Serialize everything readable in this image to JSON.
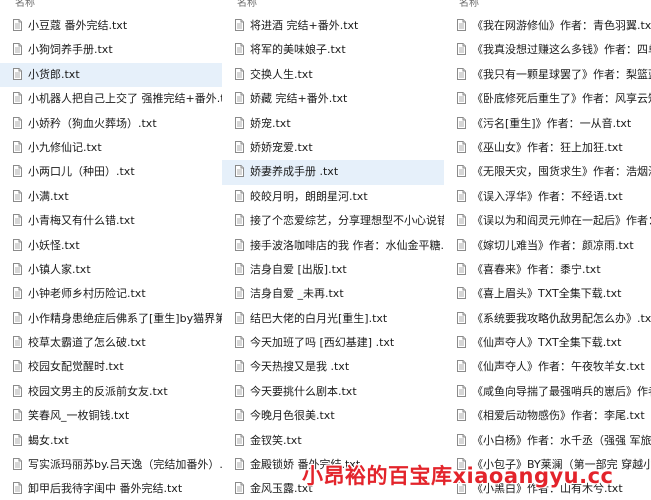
{
  "columns": [
    {
      "header": "名称",
      "files": [
        {
          "name": "小豆蔻 番外完结.txt"
        },
        {
          "name": "小狗饲养手册.txt"
        },
        {
          "name": "小货郎.txt",
          "selected": true
        },
        {
          "name": "小机器人把自己上交了 强推完结+番外.txt"
        },
        {
          "name": "小娇矜（狗血火葬场）.txt"
        },
        {
          "name": "小九修仙记.txt"
        },
        {
          "name": "小两口儿（种田）.txt"
        },
        {
          "name": "小满.txt"
        },
        {
          "name": "小青梅又有什么错.txt"
        },
        {
          "name": "小妖怪.txt"
        },
        {
          "name": "小镇人家.txt"
        },
        {
          "name": "小钟老师乡村历险记.txt"
        },
        {
          "name": "小作精身患绝症后佛系了[重生]by猫界第..."
        },
        {
          "name": "校草太霸道了怎么破.txt"
        },
        {
          "name": "校园女配觉醒时.txt"
        },
        {
          "name": "校园文男主的反派前女友.txt"
        },
        {
          "name": "笑春风_一枚铜钱.txt"
        },
        {
          "name": "蝎女.txt"
        },
        {
          "name": "写实派玛丽苏by.吕天逸（完结加番外）..."
        },
        {
          "name": "卸甲后我待字闺中 番外完结.txt"
        }
      ]
    },
    {
      "header": "名称",
      "files": [
        {
          "name": "将进酒 完结+番外.txt"
        },
        {
          "name": "将军的美味娘子.txt"
        },
        {
          "name": "交换人生.txt"
        },
        {
          "name": "娇藏 完结+番外.txt"
        },
        {
          "name": "娇宠.txt"
        },
        {
          "name": "娇娇宠爱.txt"
        },
        {
          "name": "娇妻养成手册 .txt",
          "selected": true
        },
        {
          "name": "皎皎月明，朗朗星河.txt"
        },
        {
          "name": "接了个恋爱综艺，分享理想型不小心说错..."
        },
        {
          "name": "接手波洛咖啡店的我 作者：水仙金平糖.t..."
        },
        {
          "name": "洁身自爱 [出版].txt"
        },
        {
          "name": "洁身自爱 _未再.txt"
        },
        {
          "name": "结巴大佬的白月光[重生].txt"
        },
        {
          "name": "今天加班了吗 [西幻基建] .txt"
        },
        {
          "name": "今天热搜又是我 .txt"
        },
        {
          "name": "今天要挑什么剧本.txt"
        },
        {
          "name": "今晚月色很美.txt"
        },
        {
          "name": "金钗笑.txt"
        },
        {
          "name": "金殿锁娇 番外完结.txt"
        },
        {
          "name": "金风玉露.txt"
        }
      ]
    },
    {
      "header": "名称",
      "files": [
        {
          "name": "《我在网游修仙》作者：青色羽翼.txt"
        },
        {
          "name": "《我真没想过赚这么多钱》作者：四单猪..."
        },
        {
          "name": "《我只有一颗星球罢了》作者：梨篮蓝.txt"
        },
        {
          "name": "《卧底修死后重生了》作者：风享云知道..."
        },
        {
          "name": "《污名[重生]》作者：一从音.txt"
        },
        {
          "name": "《巫山女》作者：狂上加狂.txt"
        },
        {
          "name": "《无限天灾，囤货求生》作者：浩烟海.txt"
        },
        {
          "name": "《误入浮华》作者：不经语.txt"
        },
        {
          "name": "《误以为和阎灵元帅在一起后》作者：宫..."
        },
        {
          "name": "《嫁切儿难当》作者：颜凉雨.txt"
        },
        {
          "name": "《喜春来》作者：黍宁.txt"
        },
        {
          "name": "《喜上眉头》TXT全集下载.txt"
        },
        {
          "name": "《系统要我攻略仇敌男配怎么办》.txt"
        },
        {
          "name": "《仙声夺人》TXT全集下载.txt"
        },
        {
          "name": "《仙声夺人》作者：午夜牧羊女.txt"
        },
        {
          "name": "《咸鱼向导揣了最强哨兵的崽后》作者：..."
        },
        {
          "name": "《相爱后动物感伤》作者：李尾.txt"
        },
        {
          "name": "《小白杨》作者：水千丞（强强 军旅文..."
        },
        {
          "name": "《小包子》BY莱澜（第一部完 穿越小胖..."
        },
        {
          "name": "《小黑白》作者：山有木兮.txt"
        }
      ]
    }
  ],
  "watermark": "小昂裕的百宝库xiaoangyu.cc",
  "icon": "text-file-icon",
  "colors": {
    "selected_bg": "#e6f0fa",
    "watermark": "#e3242b",
    "header_text": "#6d6d6d"
  }
}
